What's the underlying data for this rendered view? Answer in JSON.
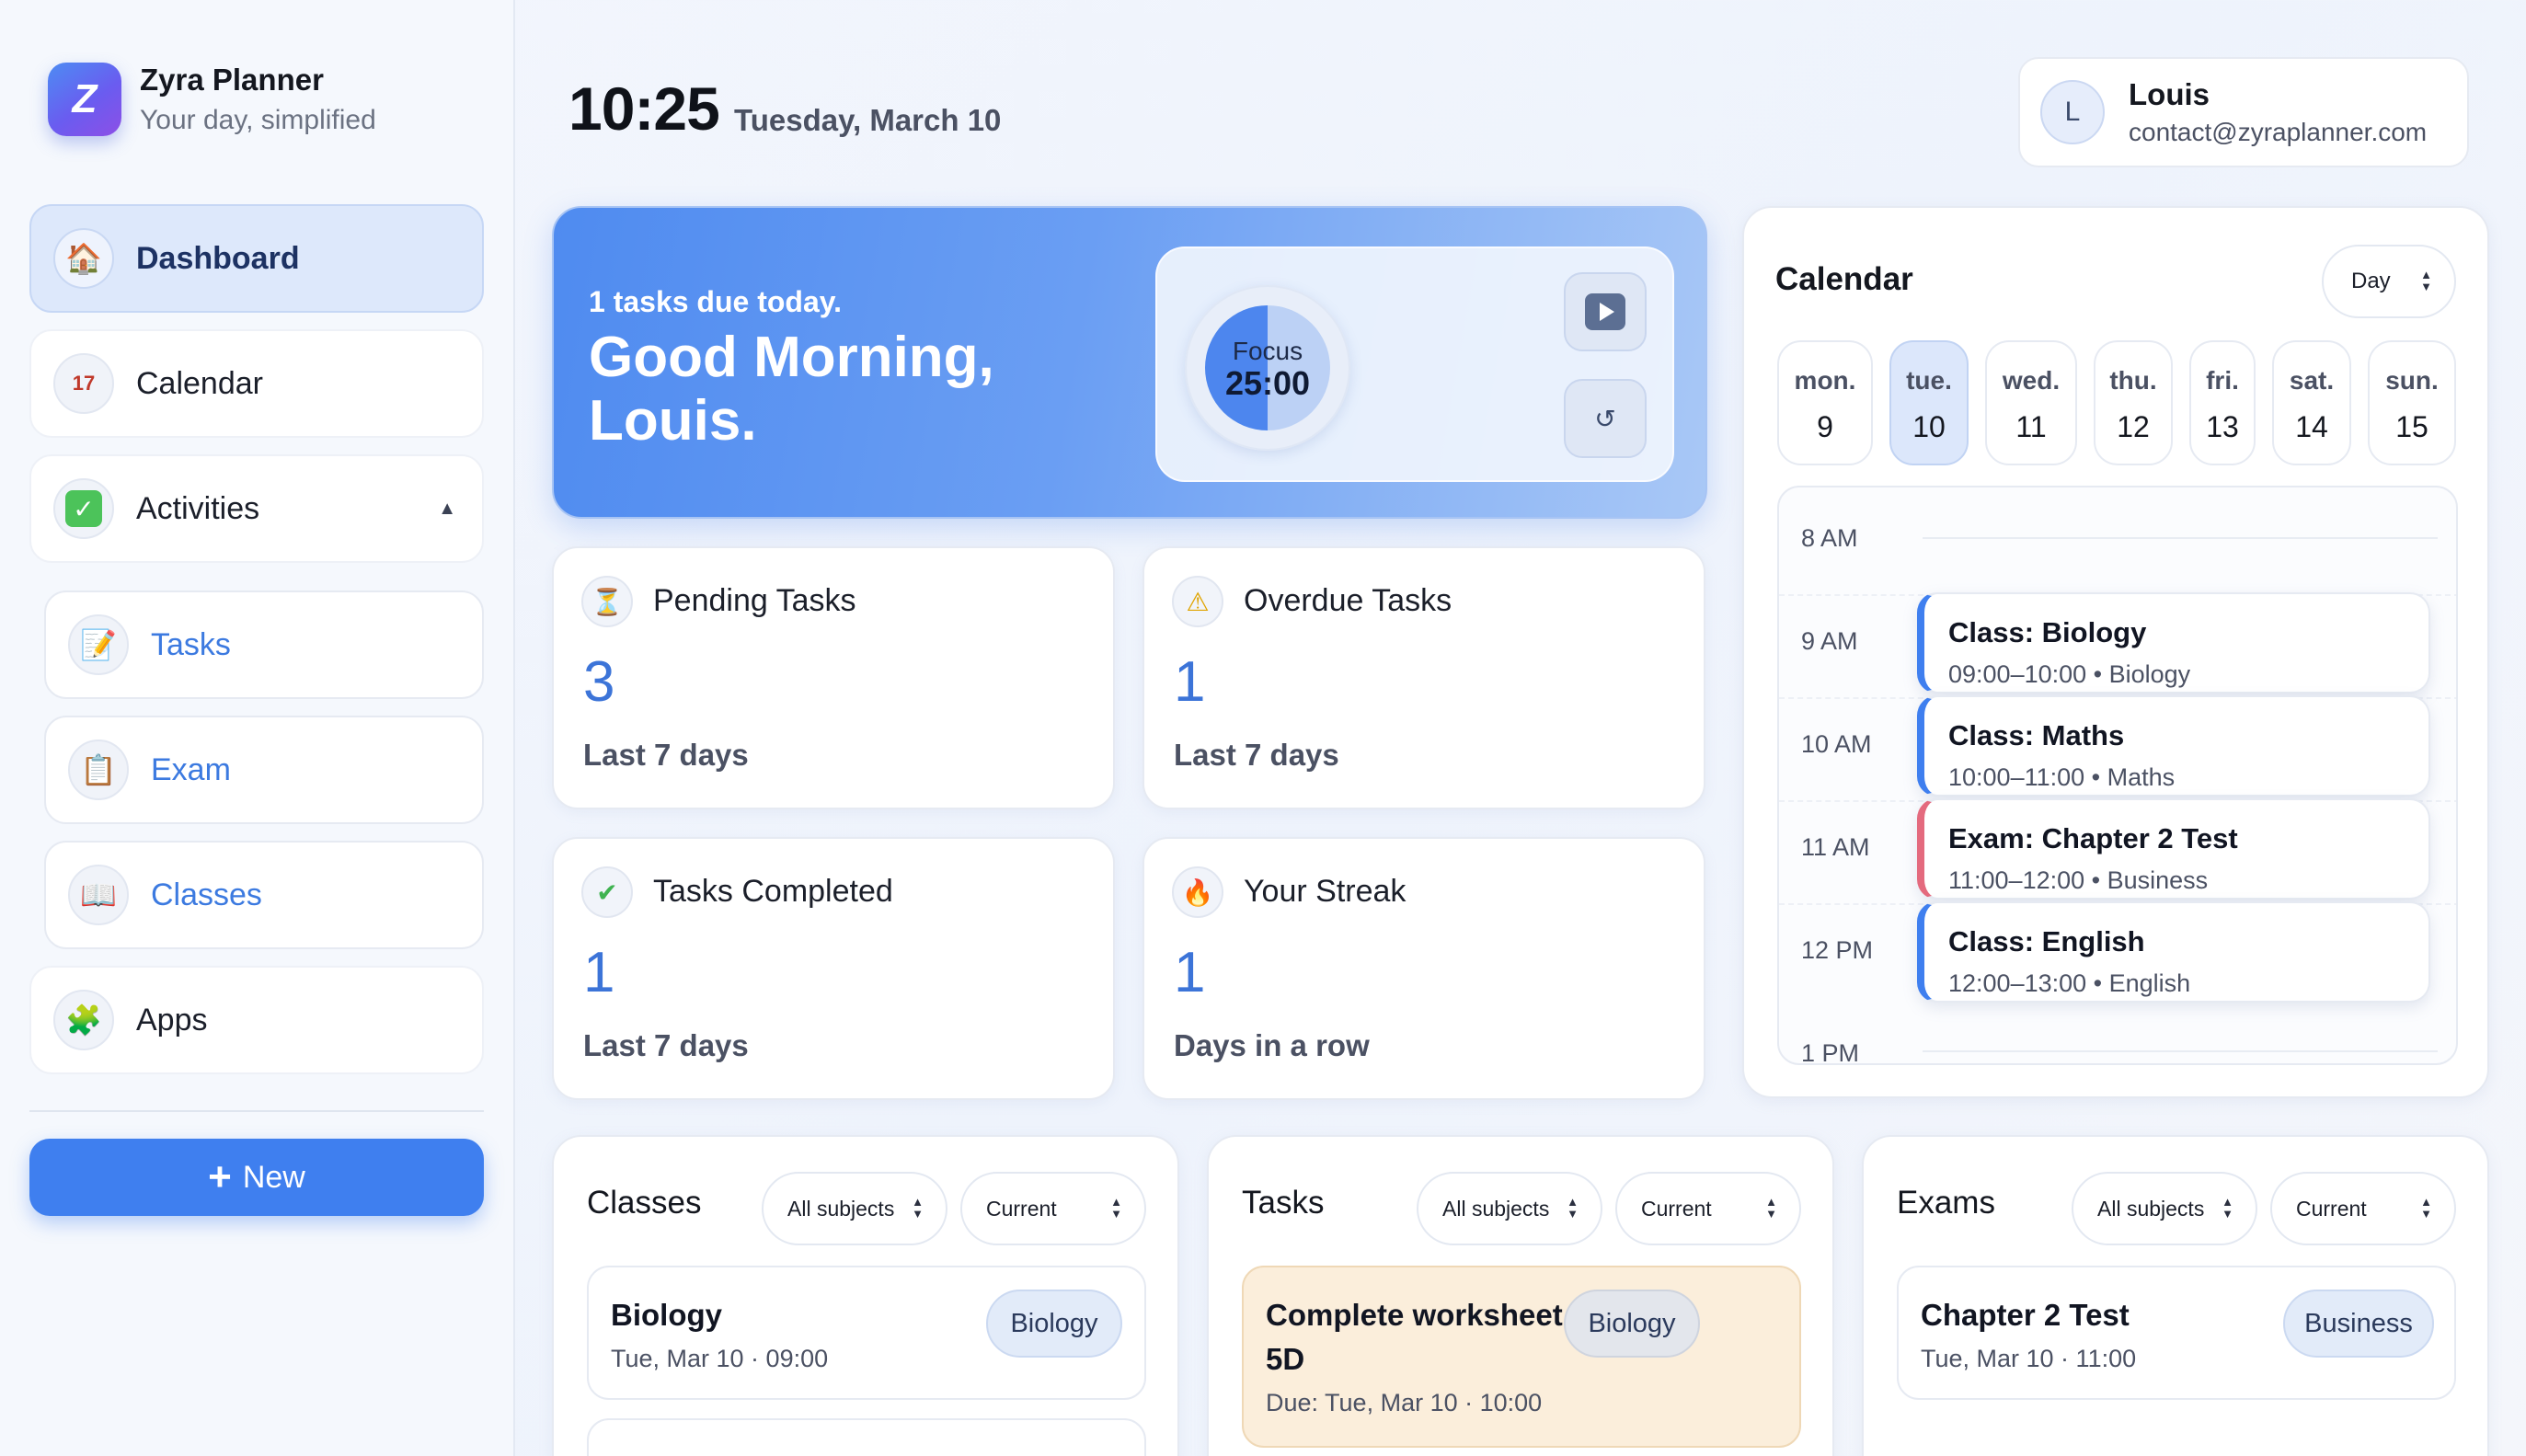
{
  "brand": {
    "logo_letter": "Z",
    "title": "Zyra Planner",
    "subtitle": "Your day, simplified"
  },
  "nav": {
    "dashboard": {
      "label": "Dashboard",
      "icon": "house-icon"
    },
    "calendar": {
      "label": "Calendar",
      "icon": "calendar-icon",
      "icon_text": "17"
    },
    "activities": {
      "label": "Activities",
      "icon": "checkmark-icon",
      "expanded": true
    },
    "subitems": [
      {
        "label": "Tasks",
        "icon": "memo-icon"
      },
      {
        "label": "Exam",
        "icon": "clipboard-icon"
      },
      {
        "label": "Classes",
        "icon": "book-icon"
      }
    ],
    "apps": {
      "label": "Apps",
      "icon": "puzzle-icon"
    },
    "new_button": "New"
  },
  "header": {
    "time": "10:25",
    "date": "Tuesday, March 10"
  },
  "user": {
    "initial": "L",
    "name": "Louis",
    "email": "contact@zyraplanner.com"
  },
  "hero": {
    "tasks_due": "1 tasks due today.",
    "greeting": "Good Morning, Louis.",
    "focus_label": "Focus",
    "focus_time": "25:00",
    "focus_progress": 0.5,
    "reset_glyph": "↺"
  },
  "stats": [
    {
      "title": "Pending Tasks",
      "value": "3",
      "sub": "Last 7 days",
      "icon": "hourglass-icon",
      "glyph": "⏳"
    },
    {
      "title": "Overdue Tasks",
      "value": "1",
      "sub": "Last 7 days",
      "icon": "warning-icon",
      "glyph": "⚠"
    },
    {
      "title": "Tasks Completed",
      "value": "1",
      "sub": "Last 7 days",
      "icon": "checkmark-icon",
      "glyph": "✔"
    },
    {
      "title": "Your Streak",
      "value": "1",
      "sub": "Days in a row",
      "icon": "fire-icon",
      "glyph": "🔥"
    }
  ],
  "calendar": {
    "title": "Calendar",
    "view": "Day",
    "days": [
      {
        "name": "mon.",
        "num": "9"
      },
      {
        "name": "tue.",
        "num": "10",
        "active": true
      },
      {
        "name": "wed.",
        "num": "11"
      },
      {
        "name": "thu.",
        "num": "12"
      },
      {
        "name": "fri.",
        "num": "13"
      },
      {
        "name": "sat.",
        "num": "14"
      },
      {
        "name": "sun.",
        "num": "15"
      }
    ],
    "hours": [
      "8 AM",
      "9 AM",
      "10 AM",
      "11 AM",
      "12 PM",
      "1 PM"
    ],
    "events": [
      {
        "title": "Class: Biology",
        "meta": "09:00–10:00 • Biology",
        "kind": "class"
      },
      {
        "title": "Class: Maths",
        "meta": "10:00–11:00 • Maths",
        "kind": "class"
      },
      {
        "title": "Exam: Chapter 2 Test",
        "meta": "11:00–12:00 • Business",
        "kind": "exam"
      },
      {
        "title": "Class: English",
        "meta": "12:00–13:00 • English",
        "kind": "class"
      }
    ]
  },
  "panels": {
    "classes": {
      "title": "Classes",
      "filter_subject": "All subjects",
      "filter_period": "Current",
      "items": [
        {
          "title": "Biology",
          "meta": "Tue, Mar 10 · 09:00",
          "tag": "Biology"
        }
      ]
    },
    "tasks": {
      "title": "Tasks",
      "filter_subject": "All subjects",
      "filter_period": "Current",
      "items": [
        {
          "title": "Complete worksheet 5D",
          "meta": "Due: Tue, Mar 10 · 10:00",
          "tag": "Biology"
        }
      ]
    },
    "exams": {
      "title": "Exams",
      "filter_subject": "All subjects",
      "filter_period": "Current",
      "items": [
        {
          "title": "Chapter 2 Test",
          "meta": "Tue, Mar 10 · 11:00",
          "tag": "Business"
        }
      ]
    }
  },
  "colors": {
    "accent": "#3f7fef",
    "value_blue": "#3c74d8",
    "exam_red": "#e46a7e",
    "task_warm": "#fbeedb"
  }
}
